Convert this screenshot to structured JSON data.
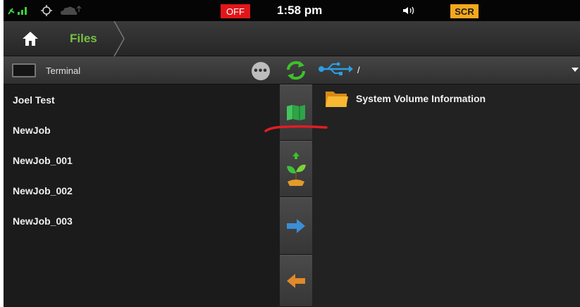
{
  "status_bar": {
    "off_label": "OFF",
    "time": "1:58 pm",
    "scr_label": "SCR",
    "icons": [
      "signal-bars-icon",
      "gps-icon",
      "cloud-icon",
      "speaker-icon"
    ]
  },
  "breadcrumb": {
    "home_icon": "home-icon",
    "current": "Files"
  },
  "left_panel": {
    "terminal_label": "Terminal",
    "jobs": [
      "Joel Test",
      "NewJob",
      "NewJob_001",
      "NewJob_002",
      "NewJob_003"
    ]
  },
  "actions": {
    "icons": [
      "refresh-icon",
      "map-icon",
      "plant-upload-icon",
      "arrow-right-icon",
      "arrow-left-icon"
    ]
  },
  "right_panel": {
    "path": "/",
    "files": [
      {
        "name": "System Volume Information",
        "icon": "folder-icon"
      }
    ]
  },
  "colors": {
    "accent_green": "#74c043",
    "off_red": "#e0171a",
    "scr_orange": "#f4a81c",
    "usb_blue": "#2b9fe6",
    "arrow_blue": "#3b8ed6",
    "arrow_orange": "#e0892a",
    "annotation_red": "#e11d24"
  }
}
